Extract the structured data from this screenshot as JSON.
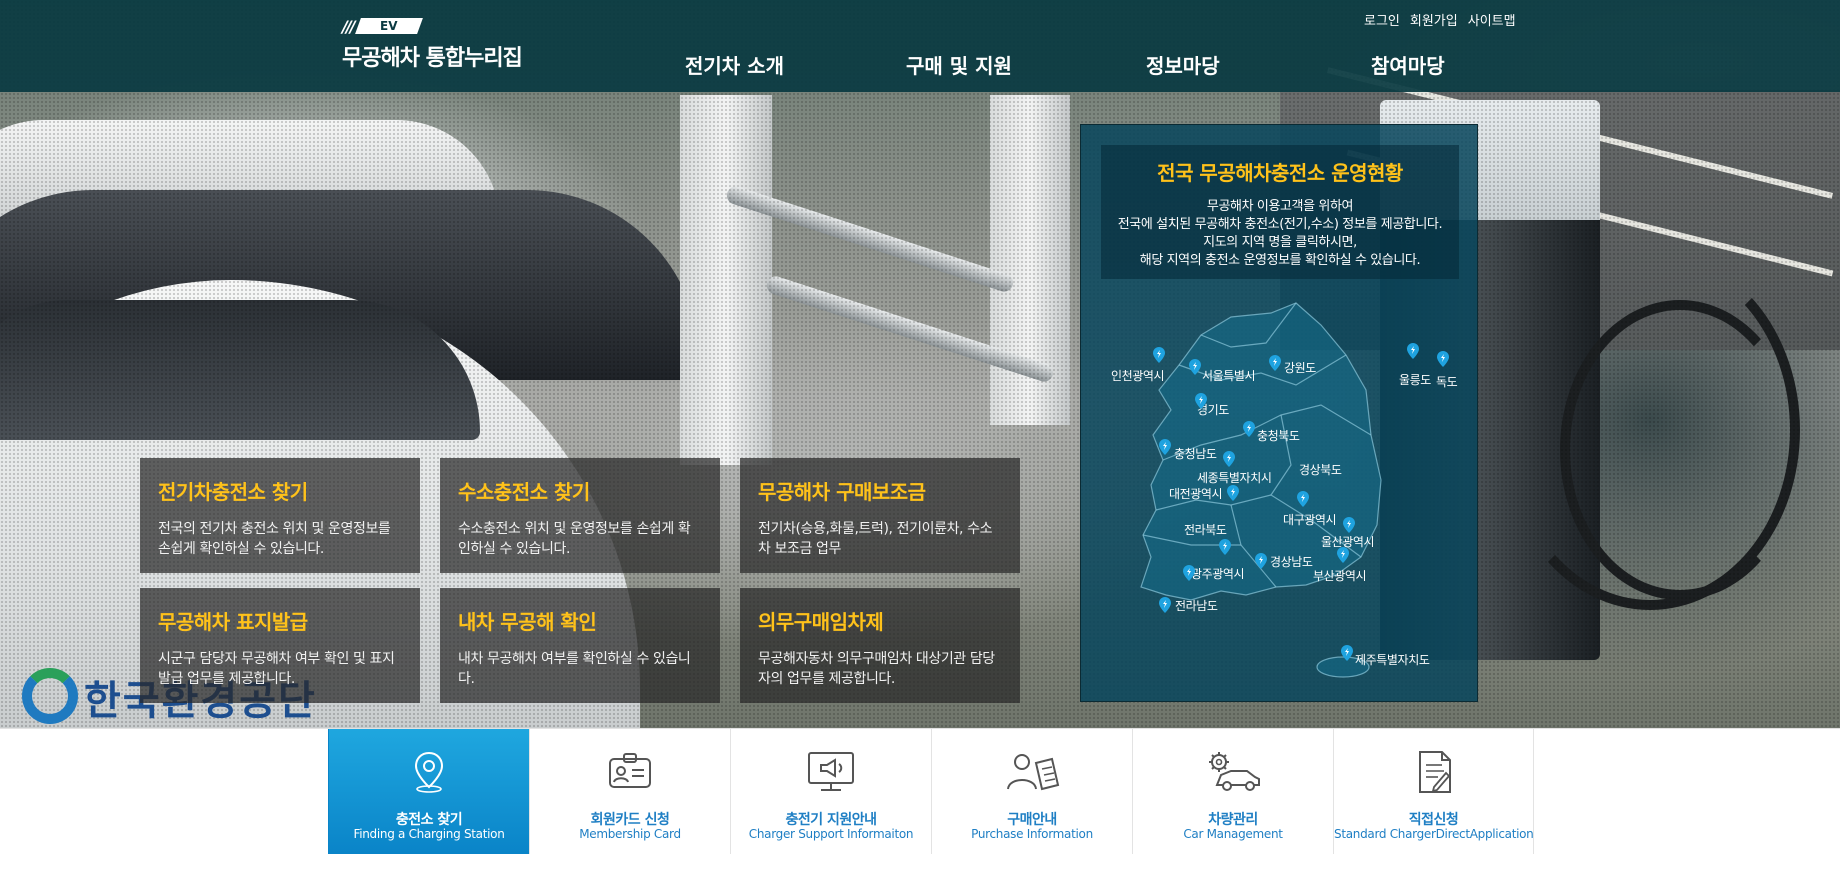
{
  "header": {
    "ev_tag": "EV",
    "brand_name": "무공해차 통합누리집",
    "util_links": [
      "로그인",
      "회원가입",
      "사이트맵"
    ],
    "nav": [
      "전기차 소개",
      "구매 및 지원",
      "정보마당",
      "참여마당"
    ]
  },
  "hero": {
    "watermark_logo": "한국환경공단"
  },
  "tiles": [
    {
      "title": "전기차충전소 찾기",
      "desc": "전국의 전기차 충전소 위치 및 운영정보를 손쉽게 확인하실 수 있습니다."
    },
    {
      "title": "수소충전소 찾기",
      "desc": "수소충전소 위치 및 운영정보를 손쉽게 확인하실 수 있습니다."
    },
    {
      "title": "무공해차 구매보조금",
      "desc": "전기차(승용,화물,트럭), 전기이륜차, 수소차 보조금 업무"
    },
    {
      "title": "무공해차 표지발급",
      "desc": "시군구 담당자 무공해차 여부 확인 및 표지발급 업무를 제공합니다."
    },
    {
      "title": "내차 무공해 확인",
      "desc": "내차 무공해차 여부를 확인하실 수 있습니다."
    },
    {
      "title": "의무구매임차제",
      "desc": "무공해자동차 의무구매임차 대상기관 담당자의 업무를 제공합니다."
    }
  ],
  "status_panel": {
    "title": "전국 무공해차충전소 운영현황",
    "desc_lines": [
      "무공해차 이용고객을 위하여",
      "전국에 설치된 무공해차 충전소(전기,수소) 정보를 제공합니다.",
      "지도의 지역 명을 클릭하시면,",
      "해당 지역의 충전소 운영정보를 확인하실 수 있습니다."
    ],
    "regions": [
      "인천광역시",
      "서울특별시",
      "강원도",
      "울릉도",
      "독도",
      "경기도",
      "충청북도",
      "충청남도",
      "세종특별자치시",
      "경상북도",
      "대전광역시",
      "전라북도",
      "대구광역시",
      "울산광역시",
      "경상남도",
      "광주광역시",
      "부산광역시",
      "전라남도",
      "제주특별자치도"
    ]
  },
  "quick_menu": [
    {
      "ko": "충전소 찾기",
      "en": "Finding a Charging Station",
      "icon": "location-pin-icon"
    },
    {
      "ko": "회원카드 신청",
      "en": "Membership Card",
      "icon": "id-card-icon"
    },
    {
      "ko": "충전기 지원안내",
      "en": "Charger Support Informaiton",
      "icon": "monitor-megaphone-icon"
    },
    {
      "ko": "구매안내",
      "en": "Purchase Information",
      "icon": "person-document-icon"
    },
    {
      "ko": "차량관리",
      "en": "Car Management",
      "icon": "gear-car-icon"
    },
    {
      "ko": "직접신청",
      "en": "Standard ChargerDirectApplication",
      "icon": "document-pen-icon"
    }
  ],
  "colors": {
    "header_bg": "#0a3a42",
    "accent_yellow": "#ffc21a",
    "quick_blue": "#1f7fc4",
    "quick_active": "#0a84c8",
    "panel_bg": "#08465c"
  }
}
